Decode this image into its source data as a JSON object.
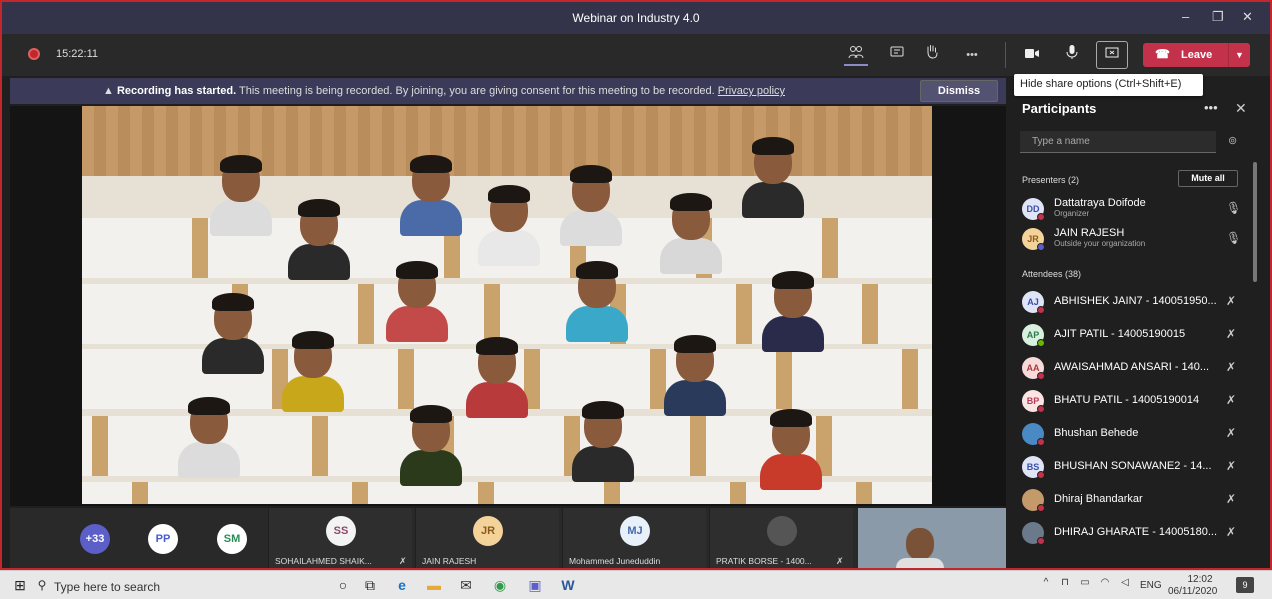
{
  "window": {
    "title": "Webinar on Industry 4.0",
    "controls": [
      "–",
      "❐",
      "✕"
    ]
  },
  "callbar": {
    "timer": "15:22:11",
    "icons": {
      "participants": "people-icon",
      "chat": "chat-icon",
      "raise_hand": "hand-icon",
      "more": "•••",
      "camera": "camera-icon",
      "mic": "mic-icon",
      "share": "share-tray-icon"
    },
    "leave_label": "Leave",
    "tooltip": "Hide share options (Ctrl+Shift+E)"
  },
  "banner": {
    "bold": "Recording has started.",
    "text": "This meeting is being recorded. By joining, you are giving consent for this meeting to be recorded.",
    "link": "Privacy policy",
    "dismiss": "Dismiss"
  },
  "strip": {
    "overflow": "+33",
    "avatars": [
      {
        "initials": "PP",
        "bg": "#ffffff",
        "fg": "#4a5bd0"
      },
      {
        "initials": "SM",
        "bg": "#ffffff",
        "fg": "#2e8b57"
      }
    ],
    "tiles": [
      {
        "initials": "SS",
        "name": "SOHAILAHMED SHAIK...",
        "muted": true,
        "bg": "#f3f3f3",
        "fg": "#8a4a6a"
      },
      {
        "initials": "JR",
        "name": "JAIN RAJESH",
        "muted": false,
        "bg": "#f4d39a",
        "fg": "#8a5a1a"
      },
      {
        "initials": "MJ",
        "name": "Mohammed Juneduddin",
        "muted": false,
        "bg": "#e8f0fa",
        "fg": "#4668a8"
      },
      {
        "initials": "",
        "name": "PRATIK BORSE - 1400...",
        "muted": true,
        "bg": "#555555",
        "fg": "#ffffff"
      }
    ]
  },
  "panel": {
    "title": "Participants",
    "search_placeholder": "Type a name",
    "presenters_label": "Presenters (2)",
    "mute_all": "Mute all",
    "attendees_label": "Attendees (38)",
    "presenters": [
      {
        "initials": "DD",
        "name": "Dattatraya Doifode",
        "sub": "Organizer",
        "bg": "#dfe4f7",
        "fg": "#3c4fa8",
        "status": "#c4314b"
      },
      {
        "initials": "JR",
        "name": "JAIN RAJESH",
        "sub": "Outside your organization",
        "bg": "#f4d39a",
        "fg": "#8a5a1a",
        "status": "#5b5fc7"
      }
    ],
    "attendees": [
      {
        "initials": "AJ",
        "name": "ABHISHEK JAIN7 - 140051950...",
        "bg": "#dfe4f7",
        "fg": "#3c4fa8",
        "status": "#c4314b"
      },
      {
        "initials": "AP",
        "name": "AJIT PATIL - 14005190015",
        "bg": "#d8f0e0",
        "fg": "#2e7a4a",
        "status": "#6bb700"
      },
      {
        "initials": "AA",
        "name": "AWAISAHMAD ANSARI - 140...",
        "bg": "#f7dada",
        "fg": "#a83c3c",
        "status": "#c4314b"
      },
      {
        "initials": "BP",
        "name": "BHATU PATIL - 14005190014",
        "bg": "#fbe4e4",
        "fg": "#b83c5a",
        "status": "#c4314b"
      },
      {
        "initials": "",
        "name": "Bhushan Behede",
        "bg": "#4a8ac4",
        "fg": "#ffffff",
        "status": "#c4314b"
      },
      {
        "initials": "BS",
        "name": "BHUSHAN SONAWANE2 - 14...",
        "bg": "#dfe4f7",
        "fg": "#3c4fa8",
        "status": "#c4314b"
      },
      {
        "initials": "",
        "name": "Dhiraj Bhandarkar",
        "bg": "#c49a6a",
        "fg": "#ffffff",
        "status": "#c4314b"
      },
      {
        "initials": "",
        "name": "DHIRAJ GHARATE - 14005180...",
        "bg": "#6a7a8a",
        "fg": "#ffffff",
        "status": "#c4314b"
      }
    ]
  },
  "taskbar": {
    "search_placeholder": "Type here to search",
    "tray_lang": "ENG",
    "time": "12:02",
    "date": "06/11/2020",
    "notifications": "9"
  }
}
